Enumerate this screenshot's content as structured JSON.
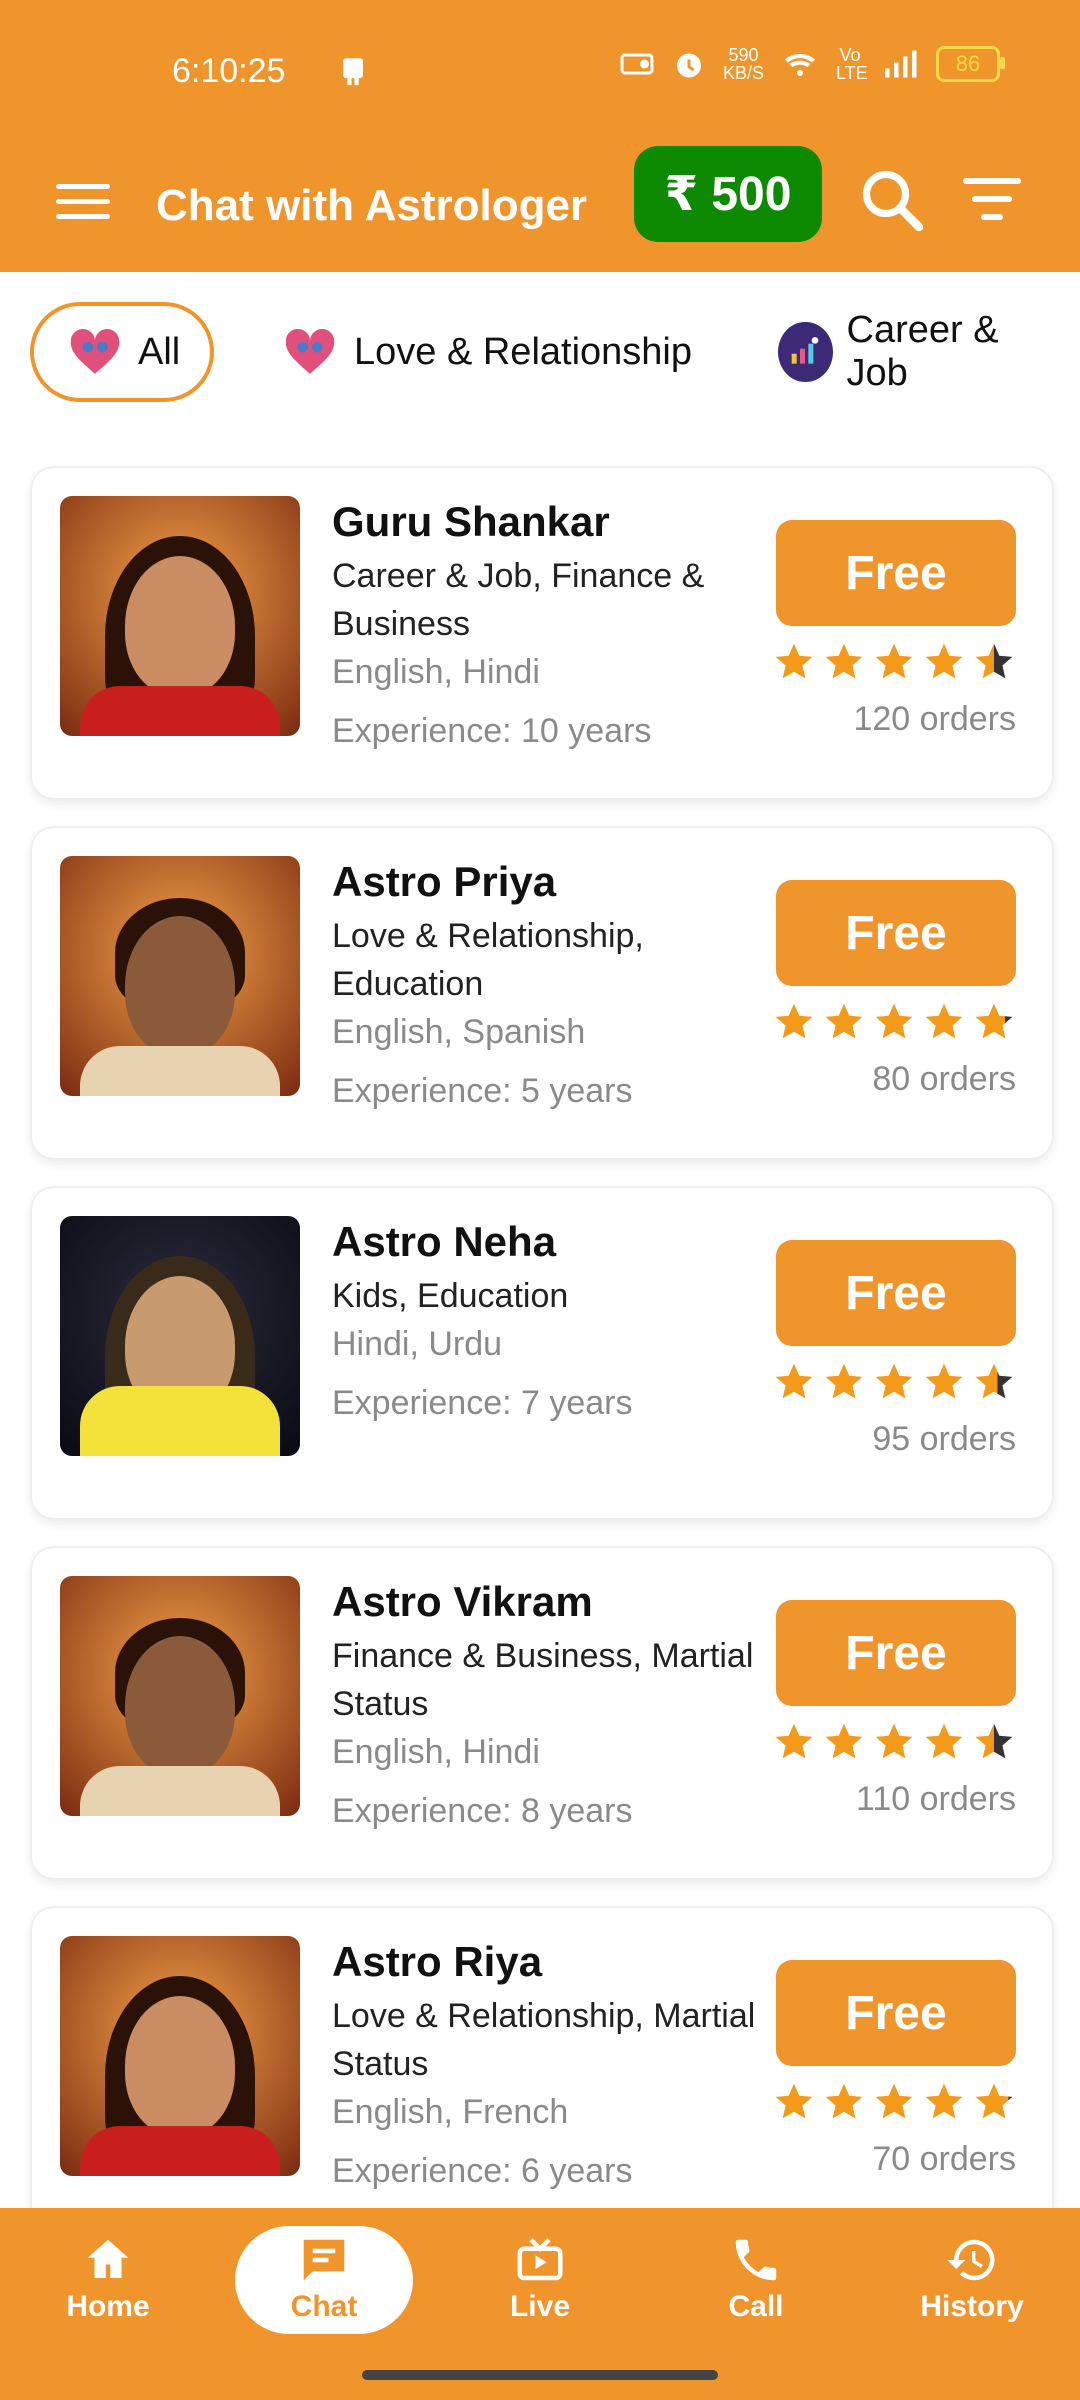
{
  "status_bar": {
    "time": "6:10:25",
    "net_speed_value": "590",
    "net_speed_unit": "KB/S",
    "volte_label": "Vo LTE",
    "battery": "86"
  },
  "app_bar": {
    "title": "Chat with Astrologer",
    "wallet_balance": "₹ 500"
  },
  "categories": [
    {
      "label": "All",
      "active": true
    },
    {
      "label": "Love & Relationship",
      "active": false
    },
    {
      "label": "Career & Job",
      "active": false
    }
  ],
  "astrologers": [
    {
      "name": "Guru Shankar",
      "skills": "Career & Job, Finance & Business",
      "languages": "English, Hindi",
      "experience": "Experience: 10 years",
      "button": "Free",
      "rating": 4.5,
      "orders": "120 orders"
    },
    {
      "name": "Astro Priya",
      "skills": "Love & Relationship, Education",
      "languages": "English, Spanish",
      "experience": "Experience: 5 years",
      "button": "Free",
      "rating": 4.8,
      "orders": "80 orders"
    },
    {
      "name": "Astro Neha",
      "skills": "Kids, Education",
      "languages": "Hindi, Urdu",
      "experience": "Experience: 7 years",
      "button": "Free",
      "rating": 4.6,
      "orders": "95 orders"
    },
    {
      "name": "Astro Vikram",
      "skills": "Finance & Business, Martial Status",
      "languages": "English, Hindi",
      "experience": "Experience: 8 years",
      "button": "Free",
      "rating": 4.5,
      "orders": "110 orders"
    },
    {
      "name": "Astro Riya",
      "skills": "Love & Relationship, Martial Status",
      "languages": "English, French",
      "experience": "Experience: 6 years",
      "button": "Free",
      "rating": 4.9,
      "orders": "70 orders"
    }
  ],
  "bottom_nav": [
    {
      "label": "Home",
      "icon": "home-icon",
      "active": false
    },
    {
      "label": "Chat",
      "icon": "chat-icon",
      "active": true
    },
    {
      "label": "Live",
      "icon": "live-tv-icon",
      "active": false
    },
    {
      "label": "Call",
      "icon": "phone-icon",
      "active": false
    },
    {
      "label": "History",
      "icon": "history-icon",
      "active": false
    }
  ],
  "colors": {
    "primary": "#f0952c",
    "wallet": "#0e8a00",
    "star": "#f39a1b"
  }
}
